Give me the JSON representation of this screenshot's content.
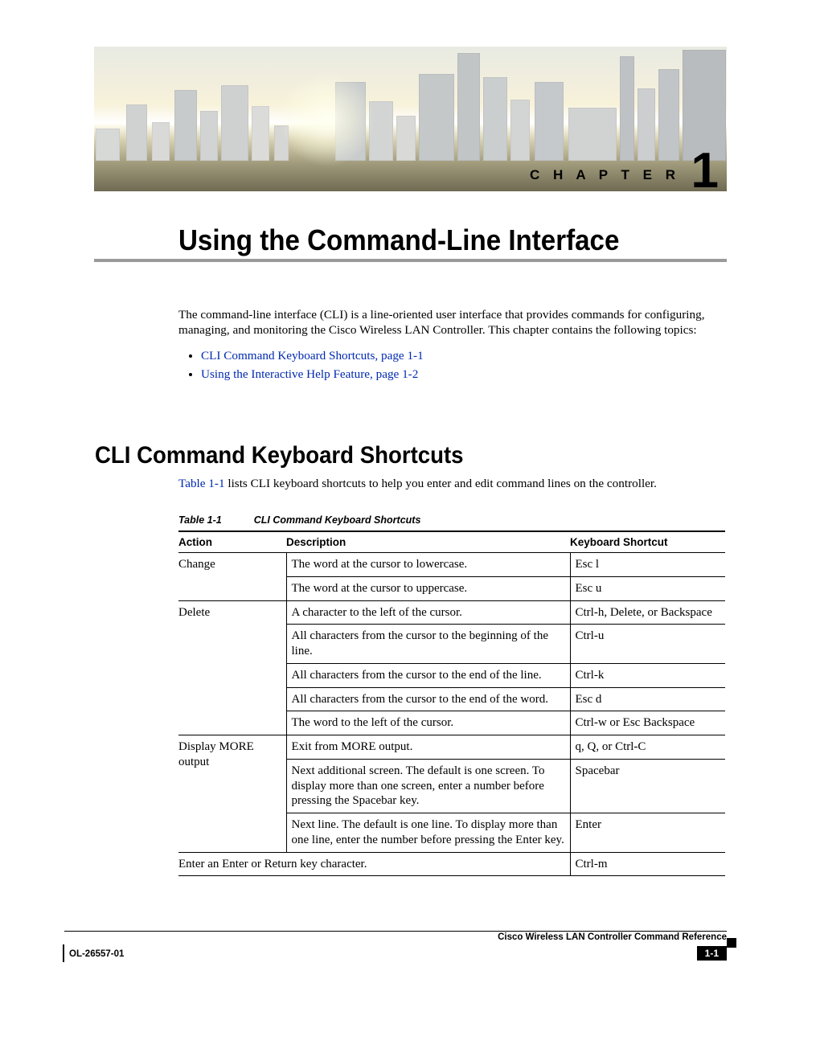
{
  "chapter": {
    "label": "C H A P T E R",
    "number": "1"
  },
  "title": "Using the Command-Line Interface",
  "intro": "The command-line interface (CLI) is a line-oriented user interface that provides commands for configuring, managing, and monitoring the Cisco Wireless LAN Controller. This chapter contains the following topics:",
  "toc": [
    "CLI Command Keyboard Shortcuts, page 1-1",
    "Using the Interactive Help Feature, page 1-2"
  ],
  "section_heading": "CLI Command Keyboard Shortcuts",
  "section_intro_link": "Table 1-1",
  "section_intro_text": " lists CLI keyboard shortcuts to help you enter and edit command lines on the controller.",
  "table": {
    "number": "Table 1-1",
    "title": "CLI Command Keyboard Shortcuts",
    "headers": {
      "action": "Action",
      "description": "Description",
      "shortcut": "Keyboard Shortcut"
    },
    "rows": [
      {
        "action": "Change",
        "description": "The word at the cursor to lowercase.",
        "shortcut": "Esc l"
      },
      {
        "action": "",
        "description": "The word at the cursor to uppercase.",
        "shortcut": "Esc u"
      },
      {
        "action": "Delete",
        "description": "A character to the left of the cursor.",
        "shortcut": "Ctrl-h, Delete, or Backspace"
      },
      {
        "action": "",
        "description": "All characters from the cursor to the beginning of the line.",
        "shortcut": "Ctrl-u"
      },
      {
        "action": "",
        "description": "All characters from the cursor to the end of the line.",
        "shortcut": "Ctrl-k"
      },
      {
        "action": "",
        "description": "All characters from the cursor to the end of the word.",
        "shortcut": "Esc d"
      },
      {
        "action": "",
        "description": "The word to the left of the cursor.",
        "shortcut": "Ctrl-w or Esc Backspace"
      },
      {
        "action": "Display MORE output",
        "description": "Exit from MORE output.",
        "shortcut": "q, Q, or Ctrl-C"
      },
      {
        "action": "",
        "description": "Next additional screen. The default is one screen. To display more than one screen, enter a number before pressing the Spacebar key.",
        "shortcut": "Spacebar"
      },
      {
        "action": "",
        "description": "Next line. The default is one line. To display more than one line, enter the number before pressing the Enter key.",
        "shortcut": "Enter"
      },
      {
        "action": "Enter an Enter or Return key character.",
        "description": "",
        "shortcut": "Ctrl-m",
        "span": true
      }
    ]
  },
  "footer": {
    "book_title": "Cisco Wireless LAN Controller Command Reference",
    "doc_number": "OL-26557-01",
    "page_number": "1-1"
  }
}
